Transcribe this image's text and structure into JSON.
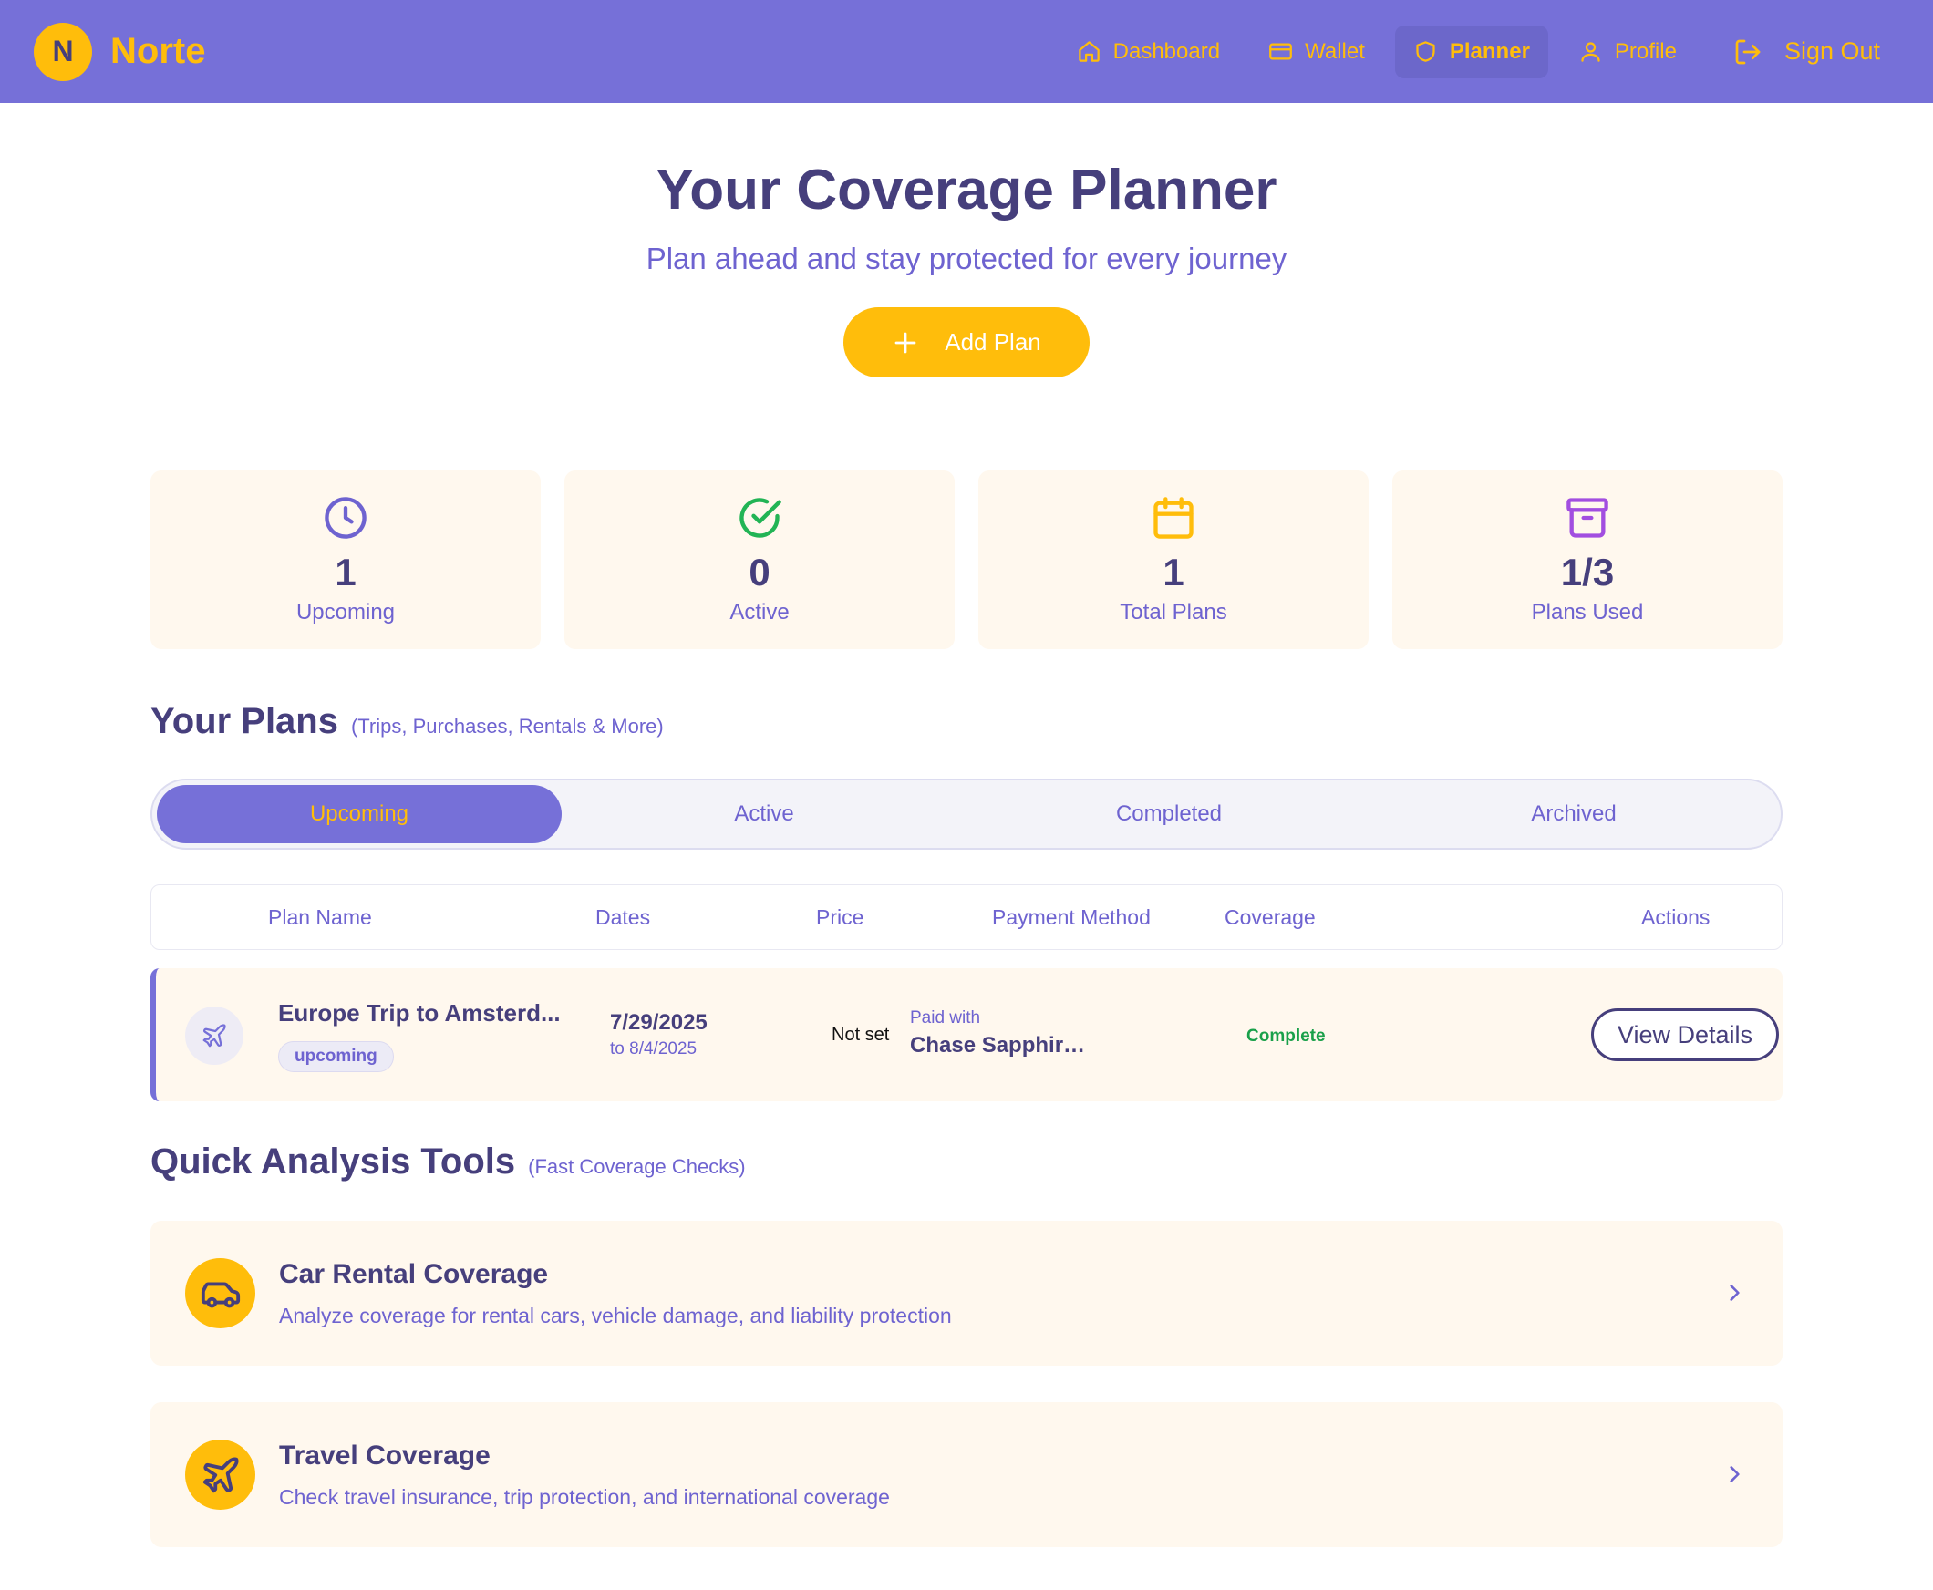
{
  "header": {
    "logo_letter": "N",
    "brand": "Norte",
    "nav": [
      {
        "label": "Dashboard",
        "icon": "home-icon"
      },
      {
        "label": "Wallet",
        "icon": "card-icon"
      },
      {
        "label": "Planner",
        "icon": "shield-icon",
        "active": true
      },
      {
        "label": "Profile",
        "icon": "user-icon"
      }
    ],
    "signout_label": "Sign Out"
  },
  "hero": {
    "title": "Your Coverage Planner",
    "subtitle": "Plan ahead and stay protected for every journey",
    "add_label": "Add Plan"
  },
  "stats": [
    {
      "value": "1",
      "label": "Upcoming",
      "icon": "clock-icon",
      "color": "#6e63d0"
    },
    {
      "value": "0",
      "label": "Active",
      "icon": "check-circle-icon",
      "color": "#22b455"
    },
    {
      "value": "1",
      "label": "Total Plans",
      "icon": "calendar-icon",
      "color": "#ffbd0b"
    },
    {
      "value": "1/3",
      "label": "Plans Used",
      "icon": "archive-icon",
      "color": "#a24ee0"
    }
  ],
  "plans": {
    "title": "Your Plans",
    "hint": "(Trips, Purchases, Rentals & More)",
    "tabs": [
      "Upcoming",
      "Active",
      "Completed",
      "Archived"
    ],
    "columns": [
      "Plan Name",
      "Dates",
      "Price",
      "Payment Method",
      "Coverage",
      "Actions"
    ],
    "rows": [
      {
        "name": "Europe Trip to Amsterd...",
        "status": "upcoming",
        "date_start": "7/29/2025",
        "date_end": "to 8/4/2025",
        "price": "Not set",
        "paid_label": "Paid with",
        "card": "Chase Sapphire ...",
        "coverage": "Complete",
        "action": "View Details"
      }
    ]
  },
  "tools": {
    "title": "Quick Analysis Tools",
    "hint": "(Fast Coverage Checks)",
    "items": [
      {
        "name": "Car Rental Coverage",
        "desc": "Analyze coverage for rental cars, vehicle damage, and liability protection",
        "icon": "car-icon"
      },
      {
        "name": "Travel Coverage",
        "desc": "Check travel insurance, trip protection, and international coverage",
        "icon": "plane-icon"
      }
    ]
  },
  "colors": {
    "brand_purple": "#7670d8",
    "accent_yellow": "#ffbd0b",
    "text_dark": "#463f7c",
    "text_muted": "#6e63d0",
    "card_bg": "#fff8ee",
    "success": "#1aa04a"
  }
}
